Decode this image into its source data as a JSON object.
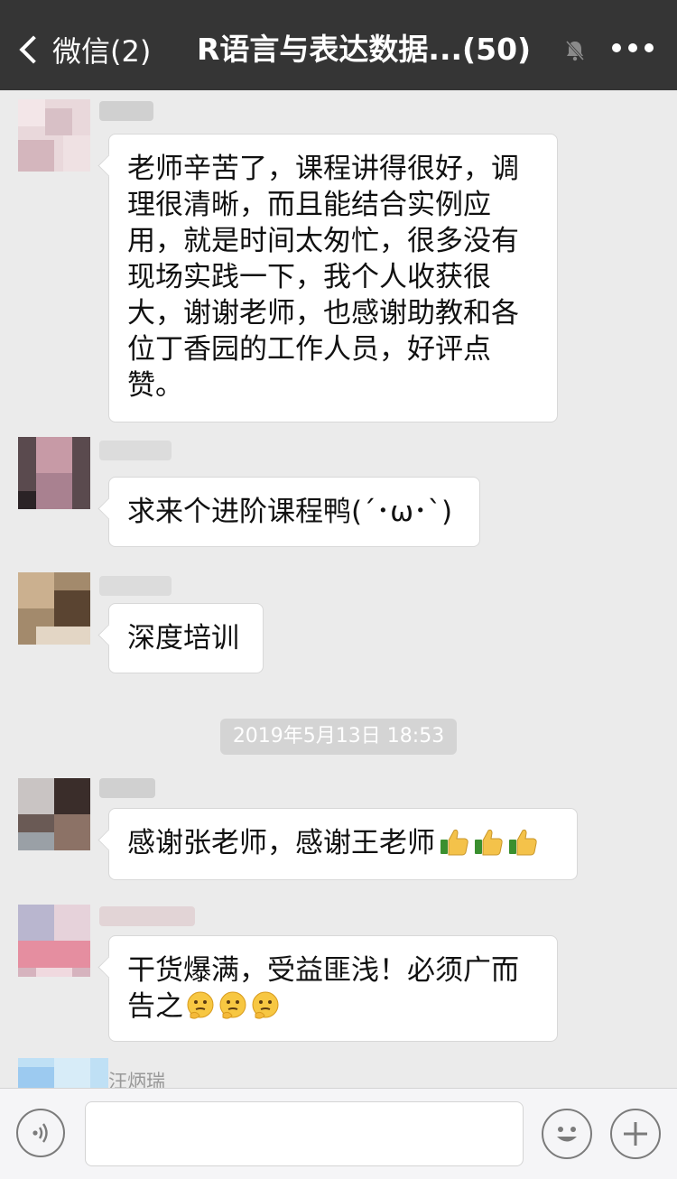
{
  "nav": {
    "back_label": "微信(2)",
    "title": "R语言与表达数据...(50)"
  },
  "messages": [
    {
      "text": "老师辛苦了，课程讲得很好，调理很清晰，而且能结合实例应用，就是时间太匆忙，很多没有现场实践一下，我个人收获很大，谢谢老师，也感谢助教和各位丁香园的工作人员，好评点赞。"
    },
    {
      "text": "求来个进阶课程鸭(´･ω･`)"
    },
    {
      "text": "深度培训"
    },
    {
      "text": "感谢张老师，感谢王老师"
    },
    {
      "text": "干货爆满，受益匪浅！必须广而告之"
    }
  ],
  "timestamp": "2019年5月13日 18:53",
  "last_sender": "汪炳瑞",
  "icons": {
    "back": "chevron-left-icon",
    "mute": "bell-off-icon",
    "more": "more-dots-icon",
    "thumbs": "thumbs-up-emoji",
    "thinking": "thinking-face-emoji",
    "voice": "voice-icon",
    "emoji": "smiley-icon",
    "plus": "plus-icon"
  },
  "colors": {
    "nav_bg": "#353535",
    "chat_bg": "#ebebeb",
    "bubble_bg": "#ffffff",
    "timestamp_bg": "#d4d4d4"
  }
}
